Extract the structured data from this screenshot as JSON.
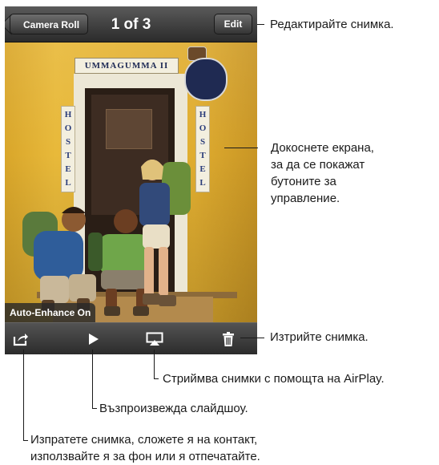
{
  "viewer": {
    "back_label": "Camera Roll",
    "counter": "1 of 3",
    "edit_label": "Edit",
    "enhance_label": "Auto-Enhance On"
  },
  "photo": {
    "sign_text": "UMMAGUMMA II",
    "hostel_letters": [
      "H",
      "O",
      "S",
      "T",
      "E",
      "L"
    ]
  },
  "toolbar": {
    "icons": [
      "share-icon",
      "play-icon",
      "airplay-icon",
      "trash-icon"
    ]
  },
  "callouts": {
    "edit": "Редактирайте снимка.",
    "tap": [
      "Докоснете екрана,",
      "за да се покажат",
      "бутоните за",
      "управление."
    ],
    "delete": "Изтрийте снимка.",
    "airplay": "Стриймва снимки с помощта на AirPlay.",
    "slideshow": "Възпроизвежда слайдшоу.",
    "share": [
      "Изпратете снимка, сложете я на контакт,",
      "използвайте я за фон или я отпечатайте."
    ]
  }
}
